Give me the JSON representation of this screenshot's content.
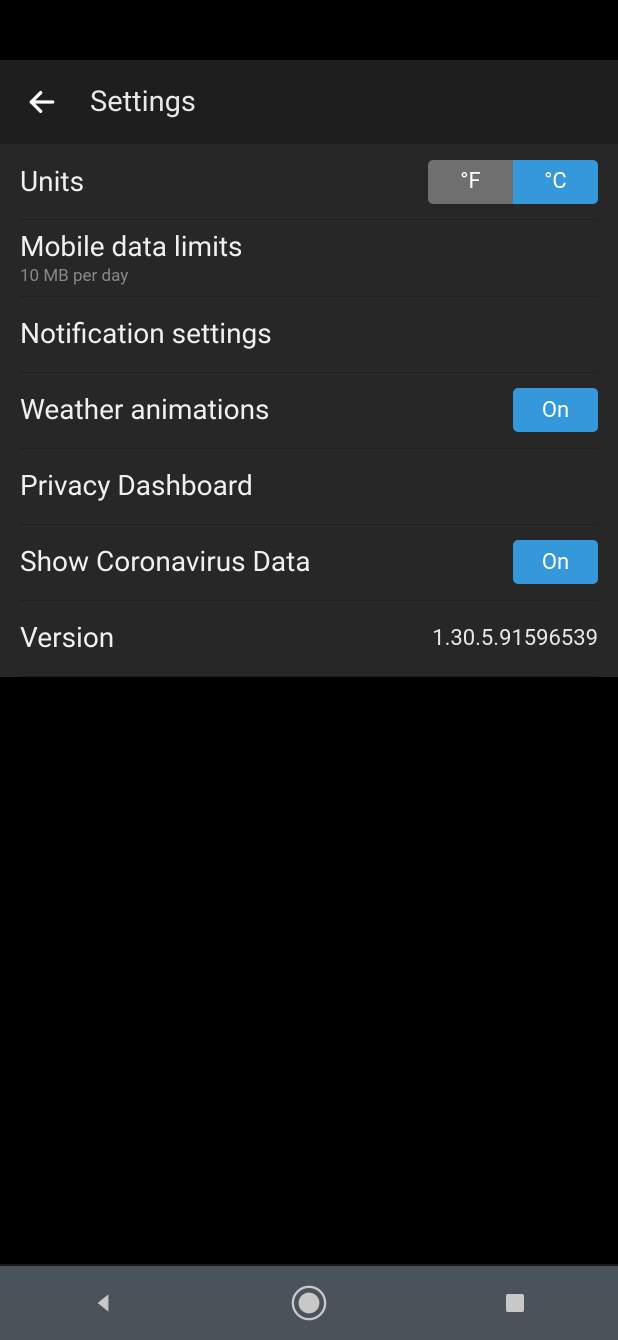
{
  "header": {
    "title": "Settings"
  },
  "settings": {
    "units": {
      "label": "Units",
      "option_f": "°F",
      "option_c": "°C",
      "selected": "°C"
    },
    "mobile_data": {
      "label": "Mobile data limits",
      "sublabel": "10 MB per day"
    },
    "notifications": {
      "label": "Notification settings"
    },
    "animations": {
      "label": "Weather animations",
      "value": "On"
    },
    "privacy": {
      "label": "Privacy Dashboard"
    },
    "coronavirus": {
      "label": "Show Coronavirus Data",
      "value": "On"
    },
    "version": {
      "label": "Version",
      "value": "1.30.5.91596539"
    }
  }
}
